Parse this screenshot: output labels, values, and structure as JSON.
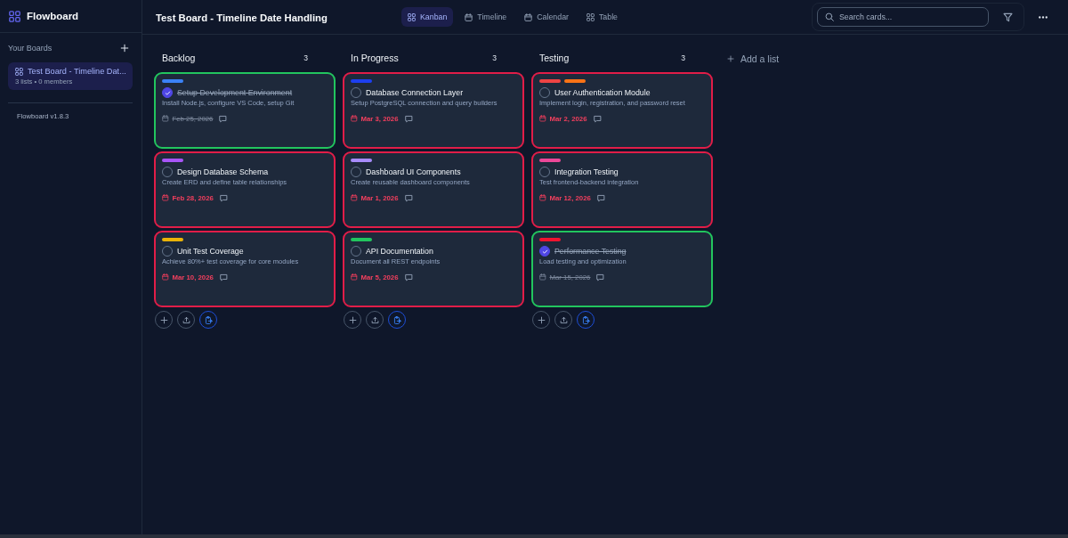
{
  "app": {
    "name": "Flowboard",
    "version": "Flowboard v1.8.3"
  },
  "sidebar": {
    "section_title": "Your Boards",
    "boards": [
      {
        "name": "Test Board - Timeline Dat...",
        "meta": "3 lists • 0 members",
        "selected": true
      }
    ]
  },
  "header": {
    "title": "Test Board - Timeline Date Handling",
    "views": [
      {
        "label": "Kanban",
        "kind": "board",
        "selected": true
      },
      {
        "label": "Timeline",
        "kind": "timeline",
        "selected": false
      },
      {
        "label": "Calendar",
        "kind": "calendar",
        "selected": false
      },
      {
        "label": "Table",
        "kind": "table",
        "selected": false
      }
    ],
    "search": {
      "placeholder": "Search cards..."
    }
  },
  "lists": [
    {
      "title": "Backlog",
      "count": "3",
      "cards": [
        {
          "labels": [
            {
              "color": "#3b82f6"
            }
          ],
          "title": "Setup Development Environment",
          "description": "Install Node.js, configure VS Code, setup Git",
          "date": "Feb 25, 2026",
          "done": true,
          "overdue": false
        },
        {
          "labels": [
            {
              "color": "#a855f7"
            }
          ],
          "title": "Design Database Schema",
          "description": "Create ERD and define table relationships",
          "date": "Feb 28, 2026",
          "done": false,
          "overdue": true
        },
        {
          "labels": [
            {
              "color": "#eab308"
            }
          ],
          "title": "Unit Test Coverage",
          "description": "Achieve 80%+ test coverage for core modules",
          "date": "Mar 10, 2026",
          "done": false,
          "overdue": true
        }
      ]
    },
    {
      "title": "In Progress",
      "count": "3",
      "cards": [
        {
          "labels": [
            {
              "color": "#1d3ff0"
            }
          ],
          "title": "Database Connection Layer",
          "description": "Setup PostgreSQL connection and query builders",
          "date": "Mar 3, 2026",
          "done": false,
          "overdue": true
        },
        {
          "labels": [
            {
              "color": "#a78bfa"
            }
          ],
          "title": "Dashboard UI Components",
          "description": "Create reusable dashboard components",
          "date": "Mar 1, 2026",
          "done": false,
          "overdue": true
        },
        {
          "labels": [
            {
              "color": "#22c55e"
            }
          ],
          "title": "API Documentation",
          "description": "Document all REST endpoints",
          "date": "Mar 5, 2026",
          "done": false,
          "overdue": true
        }
      ]
    },
    {
      "title": "Testing",
      "count": "3",
      "cards": [
        {
          "labels": [
            {
              "color": "#ef4444"
            },
            {
              "color": "#f97316"
            }
          ],
          "title": "User Authentication Module",
          "description": "Implement login, registration, and password reset",
          "date": "Mar 2, 2026",
          "done": false,
          "overdue": true
        },
        {
          "labels": [
            {
              "color": "#ec4899"
            }
          ],
          "title": "Integration Testing",
          "description": "Test frontend-backend integration",
          "date": "Mar 12, 2026",
          "done": false,
          "overdue": true
        },
        {
          "labels": [
            {
              "color": "#f0142f"
            }
          ],
          "title": "Performance Testing",
          "description": "Load testing and optimization",
          "date": "Mar 15, 2026",
          "done": true,
          "overdue": false
        }
      ]
    }
  ],
  "add_list": {
    "label": "Add a list"
  }
}
